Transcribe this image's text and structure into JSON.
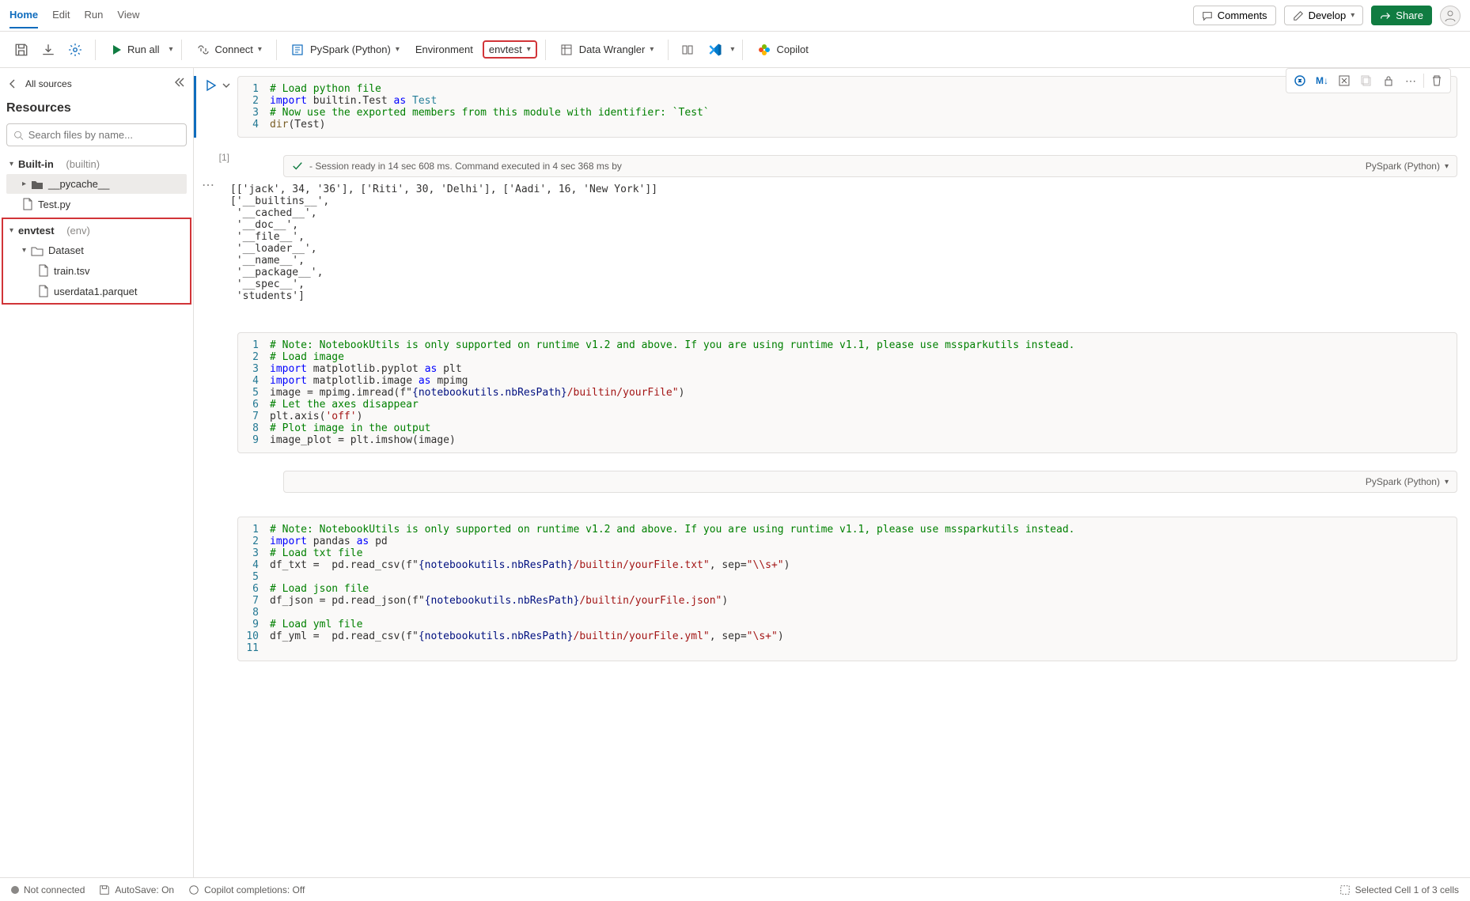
{
  "tabs": {
    "home": "Home",
    "edit": "Edit",
    "run": "Run",
    "view": "View"
  },
  "topButtons": {
    "comments": "Comments",
    "develop": "Develop",
    "share": "Share"
  },
  "toolbar": {
    "runAll": "Run all",
    "connect": "Connect",
    "pyspark": "PySpark (Python)",
    "environment": "Environment",
    "envtest": "envtest",
    "dataWrangler": "Data Wrangler",
    "copilot": "Copilot"
  },
  "sidebar": {
    "back": "All sources",
    "title": "Resources",
    "searchPlaceholder": "Search files by name...",
    "builtin": {
      "label": "Built-in",
      "badge": "(builtin)"
    },
    "pycache": "__pycache__",
    "testpy": "Test.py",
    "envtest": {
      "label": "envtest",
      "badge": "(env)"
    },
    "dataset": "Dataset",
    "train": "train.tsv",
    "userdata": "userdata1.parquet"
  },
  "cell1": {
    "execCount": "[1]",
    "status": "- Session ready in 14 sec 608 ms. Command executed in 4 sec 368 ms by",
    "lang": "PySpark (Python)",
    "code": {
      "l1": "# Load python file",
      "l2a": "import",
      "l2b": " builtin.Test ",
      "l2c": "as",
      "l2d": " Test",
      "l3": "# Now use the exported members from this module with identifier: `Test`",
      "l4a": "dir",
      "l4b": "(Test)"
    },
    "output": "[['jack', 34, '36'], ['Riti', 30, 'Delhi'], ['Aadi', 16, 'New York']]\n['__builtins__',\n '__cached__',\n '__doc__',\n '__file__',\n '__loader__',\n '__name__',\n '__package__',\n '__spec__',\n 'students']"
  },
  "cell2": {
    "lang": "PySpark (Python)",
    "c": {
      "l1": "# Note: NotebookUtils is only supported on runtime v1.2 and above. If you are using runtime v1.1, please use mssparkutils instead.",
      "l2": "# Load image",
      "l3a": "import",
      "l3b": " matplotlib.pyplot ",
      "l3c": "as",
      "l3d": " plt",
      "l4a": "import",
      "l4b": " matplotlib.image ",
      "l4c": "as",
      "l4d": " mpimg",
      "l5a": "image = mpimg.imread(f\"",
      "l5b": "{notebookutils.nbResPath}",
      "l5c": "/builtin/yourFile\"",
      "l5d": ")",
      "l6": "# Let the axes disappear",
      "l7a": "plt.axis(",
      "l7b": "'off'",
      "l7c": ")",
      "l8": "# Plot image in the output",
      "l9": "image_plot = plt.imshow(image)"
    }
  },
  "cell3": {
    "c": {
      "l1": "# Note: NotebookUtils is only supported on runtime v1.2 and above. If you are using runtime v1.1, please use mssparkutils instead.",
      "l2a": "import",
      "l2b": " pandas ",
      "l2c": "as",
      "l2d": " pd",
      "l3": "# Load txt file",
      "l4a": "df_txt =  pd.read_csv(f\"",
      "l4b": "{notebookutils.nbResPath}",
      "l4c": "/builtin/yourFile.txt\"",
      "l4d": ", sep=",
      "l4e": "\"\\\\s+\"",
      "l4f": ")",
      "l6": "# Load json file",
      "l7a": "df_json = pd.read_json(f\"",
      "l7b": "{notebookutils.nbResPath}",
      "l7c": "/builtin/yourFile.json\"",
      "l7d": ")",
      "l9": "# Load yml file",
      "l10a": "df_yml =  pd.read_csv(f\"",
      "l10b": "{notebookutils.nbResPath}",
      "l10c": "/builtin/yourFile.yml\"",
      "l10d": ", sep=",
      "l10e": "\"\\s+\"",
      "l10f": ")"
    }
  },
  "statusbar": {
    "connected": "Not connected",
    "autosave": "AutoSave: On",
    "copilot": "Copilot completions: Off",
    "selection": "Selected Cell 1 of 3 cells"
  },
  "actions": {
    "markdown": "M↓"
  }
}
